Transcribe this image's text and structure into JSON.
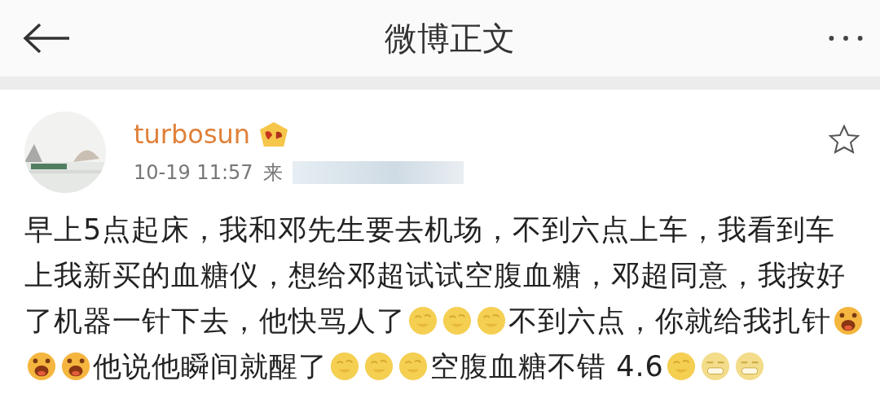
{
  "header": {
    "title": "微博正文"
  },
  "post": {
    "user": {
      "name": "turbosun"
    },
    "time": "10-19 11:57",
    "source": "来",
    "lines": [
      [
        {
          "kind": "text",
          "text": "早上5点起床，我和邓先生要去机场，不到六点上车，我看到车"
        }
      ],
      [
        {
          "kind": "text",
          "text": "上我新买的血糖仪，想给邓超试试空腹血糖，邓超同意，我按好"
        }
      ],
      [
        {
          "kind": "text",
          "text": "了机器一针下去，他快骂人了"
        },
        {
          "kind": "laugh"
        },
        {
          "kind": "laugh"
        },
        {
          "kind": "laugh"
        },
        {
          "kind": "text",
          "text": "不到六点，你就给我扎针"
        },
        {
          "kind": "shout"
        }
      ],
      [
        {
          "kind": "shout"
        },
        {
          "kind": "shout"
        },
        {
          "kind": "text",
          "text": "他说他瞬间就醒了"
        },
        {
          "kind": "laugh"
        },
        {
          "kind": "laugh"
        },
        {
          "kind": "laugh"
        },
        {
          "kind": "text",
          "text": "空腹血糖不错 4.6"
        },
        {
          "kind": "laugh"
        },
        {
          "kind": "grin"
        },
        {
          "kind": "grin"
        }
      ]
    ]
  }
}
